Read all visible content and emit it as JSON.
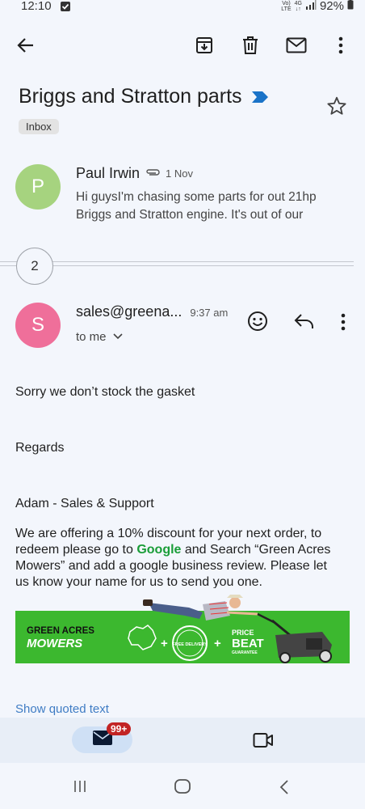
{
  "status": {
    "time": "12:10",
    "network_top": "Vo)",
    "network_bottom": "LTE",
    "gen": "4G",
    "battery": "92%"
  },
  "toolbar": {
    "back": "back-arrow-icon",
    "archive": "archive-icon",
    "delete": "delete-icon",
    "mark_unread": "mail-icon",
    "more": "more-vert-icon"
  },
  "subject": "Briggs and Stratton parts",
  "label_chip": "Inbox",
  "first_message": {
    "avatar_letter": "P",
    "avatar_color": "#a6d37f",
    "sender": "Paul Irwin",
    "date": "1 Nov",
    "snippet": "Hi guysI'm chasing some parts for out 21hp Briggs and Stratton engine. It's out of our"
  },
  "collapsed_count": "2",
  "second_message": {
    "avatar_letter": "S",
    "avatar_color": "#ef6f9a",
    "sender": "sales@greena...",
    "time": "9:37 am",
    "recipient": "to me",
    "body_line1": "Sorry we don’t stock the gasket",
    "body_line2": "Regards",
    "signature": "Adam - Sales & Support",
    "promo_before": " We are offering a 10% discount for your next order, to redeem please go to ",
    "promo_link": "Google",
    "promo_after": " and Search “Green Acres Mowers” and add a google business review. Please let us know your name for us to send you one."
  },
  "banner": {
    "brand_line1": "GREEN ACRES",
    "brand_line2": "MOWERS",
    "free_delivery": "FREE DELIVERY",
    "price_line1": "PRICE",
    "price_line2": "BEAT",
    "price_line3": "GUARANTEE",
    "green": "#3cb82f"
  },
  "show_quoted": "Show quoted text",
  "bottom_nav": {
    "badge": "99+"
  },
  "colors": {
    "accent_link": "#3f7cc4",
    "badge": "#c22424",
    "google_green": "#1a9d38",
    "important_marker": "#1a73c8"
  }
}
